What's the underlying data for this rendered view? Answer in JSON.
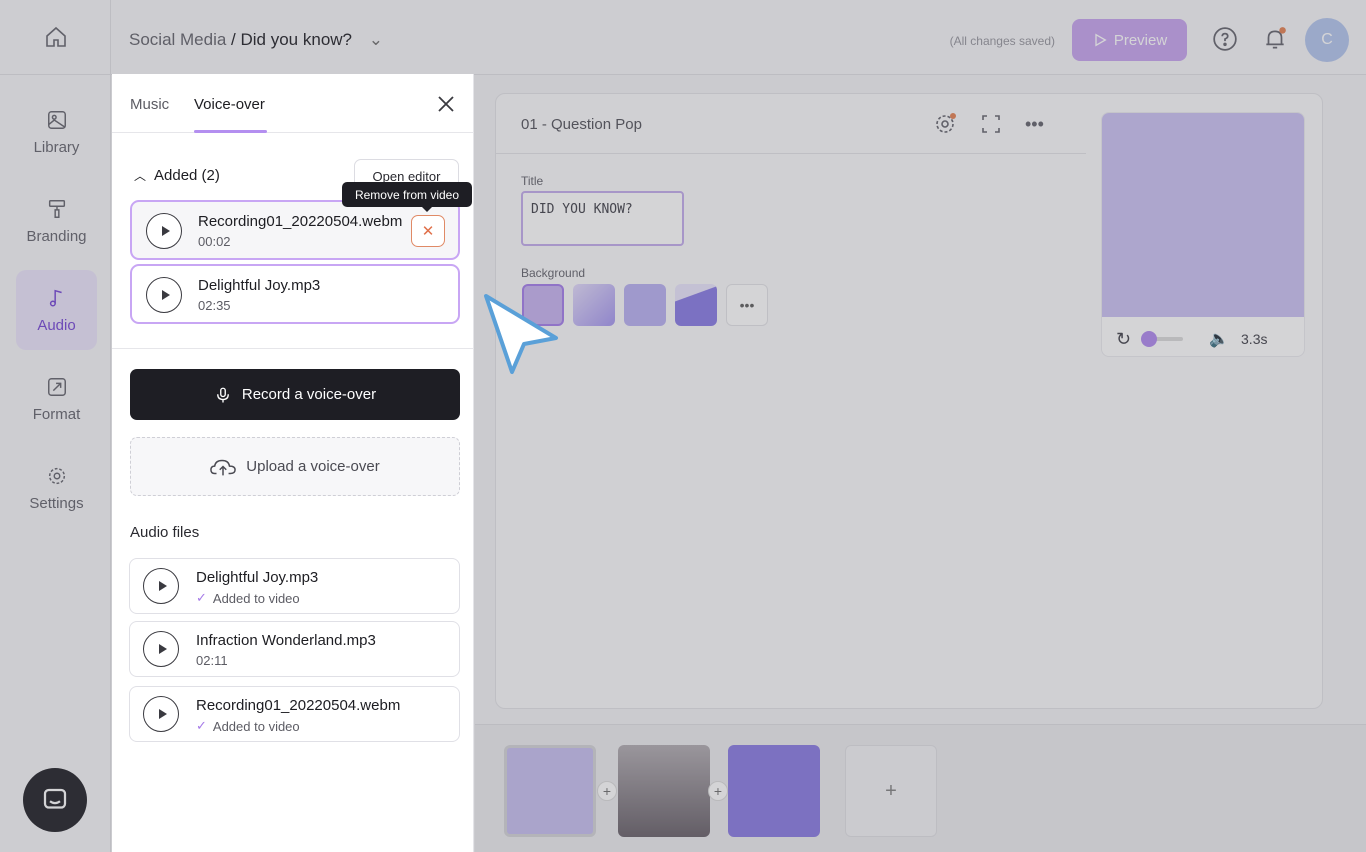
{
  "rail": {
    "items": [
      {
        "label": "Library"
      },
      {
        "label": "Branding"
      },
      {
        "label": "Audio"
      },
      {
        "label": "Format"
      },
      {
        "label": "Settings"
      }
    ]
  },
  "header": {
    "project": "Social Media",
    "separator": " / ",
    "title": "Did you know?",
    "saved_status": "(All changes saved)",
    "preview_label": "Preview",
    "avatar_initial": "C"
  },
  "editor": {
    "scene_title": "01 - Question Pop",
    "title_label": "Title",
    "title_value": "DID YOU KNOW?",
    "background_label": "Background",
    "preview_duration": "3.3s"
  },
  "panel": {
    "tabs": [
      {
        "label": "Music"
      },
      {
        "label": "Voice-over"
      }
    ],
    "added_heading": "Added (2)",
    "open_editor_label": "Open editor",
    "tooltip": "Remove from video",
    "remove_glyph": "✕",
    "added_items": [
      {
        "name": "Recording01_20220504.webm",
        "duration": "00:02"
      },
      {
        "name": "Delightful Joy.mp3",
        "duration": "02:35"
      }
    ],
    "record_label": "Record a voice-over",
    "upload_label": "Upload a voice-over",
    "files_heading": "Audio files",
    "files": [
      {
        "name": "Delightful Joy.mp3",
        "status": "Added to video"
      },
      {
        "name": "Infraction Wonderland.mp3",
        "status": "02:11"
      },
      {
        "name": "Recording01_20220504.webm",
        "status": "Added to video"
      }
    ]
  },
  "colors": {
    "accent": "#b48ff0",
    "danger": "#e0704a",
    "dark": "#1e1e24"
  }
}
